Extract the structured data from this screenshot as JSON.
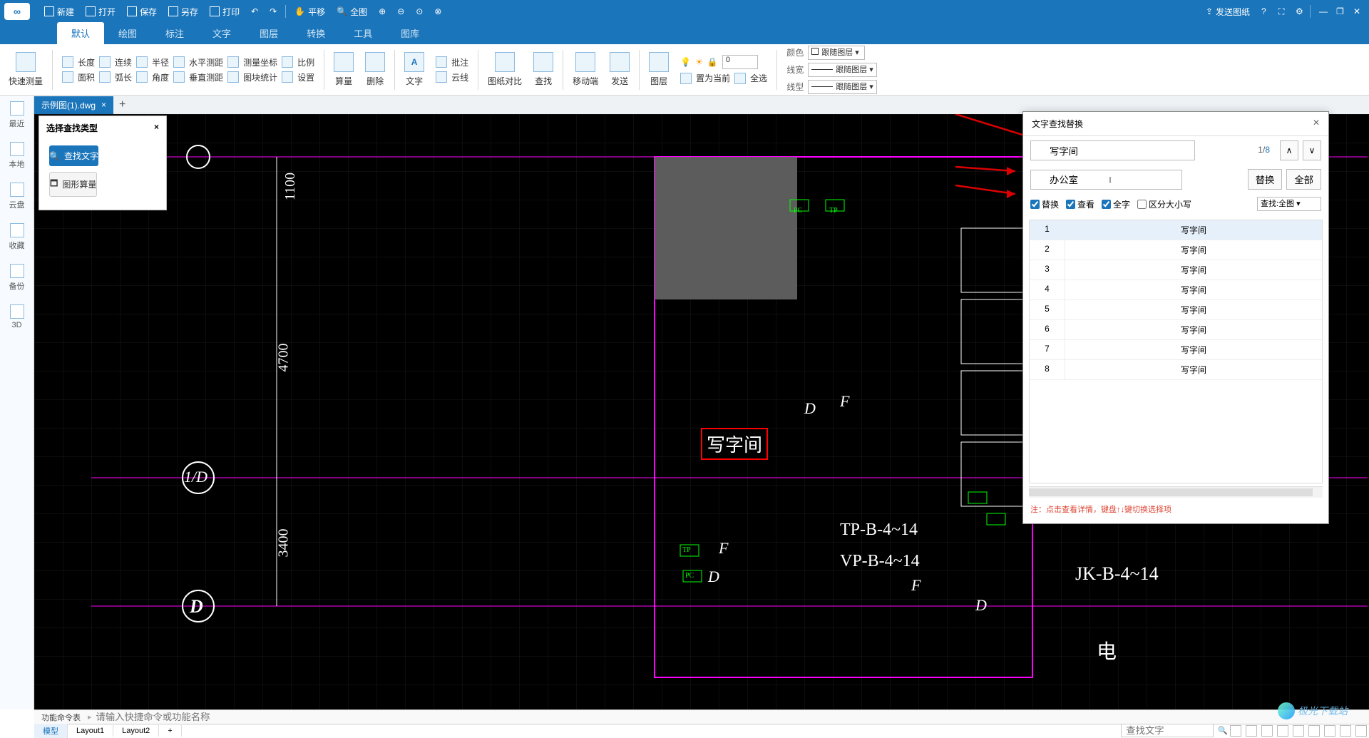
{
  "titlebar": {
    "new": "新建",
    "open": "打开",
    "save": "保存",
    "saveas": "另存",
    "print": "打印",
    "pan": "平移",
    "full": "全图",
    "send": "发送图纸"
  },
  "tabs": [
    "默认",
    "绘图",
    "标注",
    "文字",
    "图层",
    "转换",
    "工具",
    "图库"
  ],
  "ribbon": {
    "quick_measure": "快速测量",
    "r1": {
      "length": "长度",
      "continuous": "连续",
      "radius": "半径",
      "horiz": "水平测距",
      "coord": "测量坐标",
      "scale": "比例"
    },
    "r2": {
      "area": "面积",
      "arc": "弧长",
      "angle": "角度",
      "vert": "垂直测距",
      "stats": "图块统计",
      "settings": "设置"
    },
    "calc": "算量",
    "delete": "删除",
    "text": "文字",
    "annot": "批注",
    "cloud": "云线",
    "compare": "图纸对比",
    "find": "查找",
    "mobile": "移动端",
    "send2": "发送",
    "layer": "图层",
    "set_current": "置为当前",
    "select_all": "全选",
    "color": "颜色",
    "color_val": "跟随图层",
    "lineweight": "线宽",
    "lineweight_val": "跟随图层",
    "linetype": "线型",
    "linetype_val": "跟随图层",
    "layer_num": "0"
  },
  "leftbar": {
    "recent": "最近",
    "local": "本地",
    "cloud": "云盘",
    "fav": "收藏",
    "backup": "备份",
    "three_d": "3D"
  },
  "filetab": {
    "name": "示例图(1).dwg"
  },
  "searchtype": {
    "title": "选择查找类型",
    "find_text": "查找文字",
    "shape_calc": "图形算量"
  },
  "canvas": {
    "dim1100": "1100",
    "dim4700": "4700",
    "dim3400": "3400",
    "axis1D": "1/D",
    "axisD": "D",
    "highlight": "写字间",
    "lblD": "D",
    "lblF": "F",
    "lblPC": "PC",
    "lblTP": "TP",
    "tp_b": "TP-B-4~14",
    "vp_b": "VP-B-4~14",
    "jk_b": "JK-B-4~14",
    "dian": "电"
  },
  "fr": {
    "title": "文字查找替换",
    "search_value": "写字间",
    "count_cur": "1",
    "count_sep": "/",
    "count_total": "8",
    "replace_value": "办公室",
    "btn_replace": "替换",
    "btn_all": "全部",
    "chk_replace": "替换",
    "chk_view": "查看",
    "chk_whole": "全字",
    "chk_case": "区分大小写",
    "scope": "查找:全图",
    "results": [
      {
        "n": "1",
        "t": "写字间"
      },
      {
        "n": "2",
        "t": "写字间"
      },
      {
        "n": "3",
        "t": "写字间"
      },
      {
        "n": "4",
        "t": "写字间"
      },
      {
        "n": "5",
        "t": "写字间"
      },
      {
        "n": "6",
        "t": "写字间"
      },
      {
        "n": "7",
        "t": "写字间"
      },
      {
        "n": "8",
        "t": "写字间"
      }
    ],
    "note": "注：点击查看详情，键盘↑↓键切换选择项"
  },
  "cmdbar": {
    "label": "功能命令表",
    "placeholder": "请输入快捷命令或功能名称"
  },
  "status": {
    "model": "模型",
    "layout1": "Layout1",
    "layout2": "Layout2",
    "find_placeholder": "查找文字"
  },
  "watermark": "极光下载站"
}
